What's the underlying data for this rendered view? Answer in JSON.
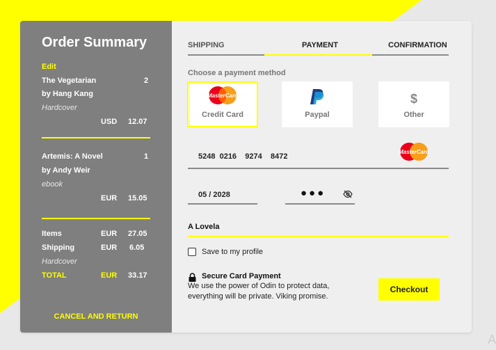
{
  "sidebar": {
    "title": "Order Summary",
    "edit_label": "Edit",
    "items": [
      {
        "name": "The Vegetarian",
        "qty": "2",
        "author": "by Hang Kang",
        "format": "Hardcover",
        "currency": "USD",
        "price": "12.07"
      },
      {
        "name": "Artemis: A Novel",
        "qty": "1",
        "author": "by Andy Weir",
        "format": "ebook",
        "currency": "EUR",
        "price": "15.05"
      }
    ],
    "totals": {
      "items_label": "Items",
      "items_currency": "EUR",
      "items_value": "27.05",
      "shipping_label": "Shipping",
      "shipping_currency": "EUR",
      "shipping_value": "6.05",
      "shipping_note": "Hardcover",
      "total_label": "TOTAL",
      "total_currency": "EUR",
      "total_value": "33.17"
    },
    "cancel_label": "CANCEL AND RETURN"
  },
  "tabs": [
    {
      "label": "SHIPPING"
    },
    {
      "label": "PAYMENT"
    },
    {
      "label": "CONFIRMATION"
    }
  ],
  "payment": {
    "choose_label": "Choose a payment method",
    "methods": [
      {
        "label": "Credit Card",
        "icon": "mastercard-icon",
        "selected": true
      },
      {
        "label": "Paypal",
        "icon": "paypal-icon",
        "selected": false
      },
      {
        "label": "Other",
        "icon": "dollar-icon",
        "symbol": "$",
        "selected": false
      }
    ],
    "card_number": "5248  0216    9274    8472",
    "expiry": "05 / 2028",
    "cvv_mask": "●●●",
    "cardholder": "A Lovela",
    "save_label": "Save to my profile",
    "secure_title": "Secure Card Payment",
    "secure_text_1": "We use the power of Odin to protect data,",
    "secure_text_2": "everything will be private. Viking promise.",
    "checkout_label": "Checkout",
    "mastercard_text": "MasterCard"
  },
  "colors": {
    "accent": "#ffff00",
    "sidebar": "#7f7f7f",
    "panel": "#efefef",
    "background": "#e8e8e8"
  },
  "corner_letter": "A"
}
